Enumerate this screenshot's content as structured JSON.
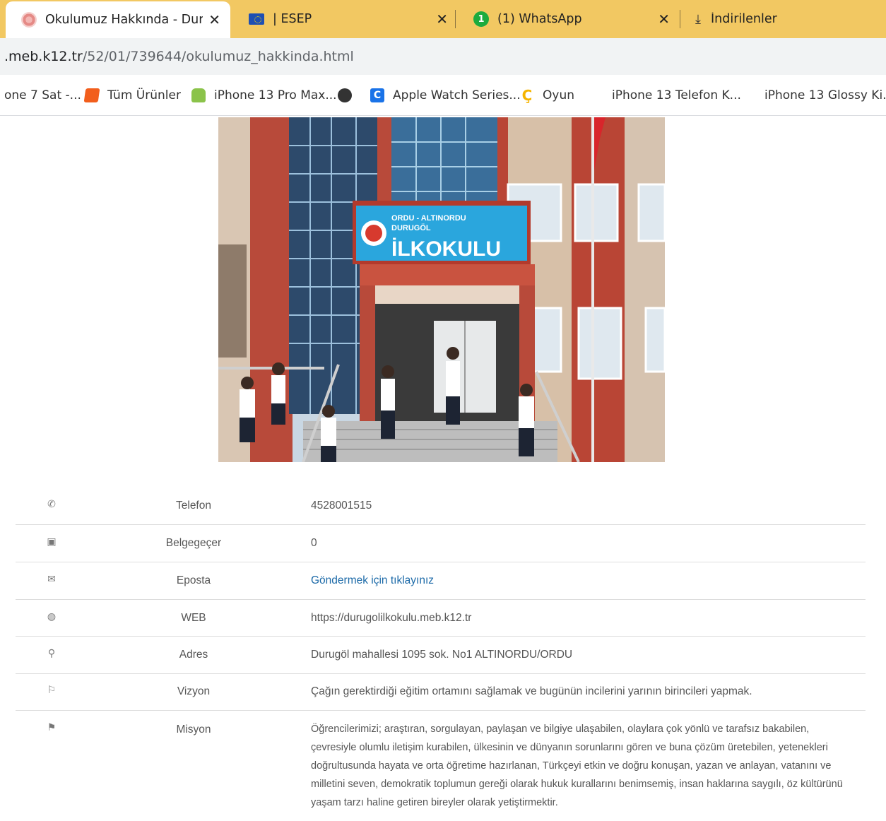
{
  "tabs": [
    {
      "title": "Okulumuz Hakkında - Durugöl",
      "close": "✕",
      "favicon": "meb-logo-icon",
      "active": true
    },
    {
      "title": "| ESEP",
      "close": "✕",
      "favicon": "eu-flag-icon"
    },
    {
      "title": "(1) WhatsApp",
      "close": "✕",
      "favicon": "whatsapp-icon",
      "badge": "1"
    },
    {
      "title": "İndirilenler",
      "favicon": "download-icon"
    }
  ],
  "address": {
    "host": ".meb.k12.tr",
    "path": "/52/01/739644/okulumuz_hakkinda.html"
  },
  "bookmarks": [
    {
      "label": "one 7 Sat -...",
      "icon": ""
    },
    {
      "label": "Tüm Ürünler",
      "icon": "feather-icon"
    },
    {
      "label": "iPhone 13 Pro Max...",
      "icon": "android-icon"
    },
    {
      "label": "",
      "icon": "globe-icon"
    },
    {
      "label": "Apple Watch Series...",
      "icon": "c-logo-icon"
    },
    {
      "label": "Oyun",
      "icon": "cc-logo-icon"
    },
    {
      "label": "iPhone 13 Telefon K...",
      "icon": ""
    },
    {
      "label": "iPhone 13 Glossy Ki...",
      "icon": ""
    }
  ],
  "photo": {
    "sign_line1": "ORDU - ALTINORDU",
    "sign_line2": "DURUGÖL",
    "sign_line3": "İLKOKULU"
  },
  "contact": [
    {
      "icon": "phone-icon",
      "label": "Telefon",
      "value": "4528001515"
    },
    {
      "icon": "fax-icon",
      "label": "Belgegeçer",
      "value": "0"
    },
    {
      "icon": "envelope-icon",
      "label": "Eposta",
      "value": "Göndermek için tıklayınız",
      "link": true
    },
    {
      "icon": "globe-icon",
      "label": "WEB",
      "value": "https://durugolilkokulu.meb.k12.tr"
    },
    {
      "icon": "map-marker-icon",
      "label": "Adres",
      "value": "Durugöl mahallesi 1095 sok. No1 ALTINORDU/ORDU"
    },
    {
      "icon": "flag-outline-icon",
      "label": "Vizyon",
      "value": "Çağın gerektirdiği eğitim ortamını sağlamak ve bugünün incilerini yarının birincileri yapmak."
    },
    {
      "icon": "flag-filled-icon",
      "label": "Misyon",
      "value": "Öğrencilerimizi; araştıran, sorgulayan, paylaşan ve bilgiye ulaşabilen, olaylara çok yönlü ve tarafsız bakabilen, çevresiyle olumlu iletişim kurabilen, ülkesinin ve dünyanın sorunlarını gören ve buna çözüm üretebilen, yetenekleri doğrultusunda hayata ve orta öğretime hazırlanan, Türkçeyi etkin ve doğru konuşan, yazan ve anlayan, vatanını ve milletini seven, demokratik toplumun gereği olarak hukuk kurallarını benimsemiş, insan haklarına saygılı, öz kültürünü yaşam tarzı haline getiren bireyler olarak yetiştirmektir."
    }
  ]
}
